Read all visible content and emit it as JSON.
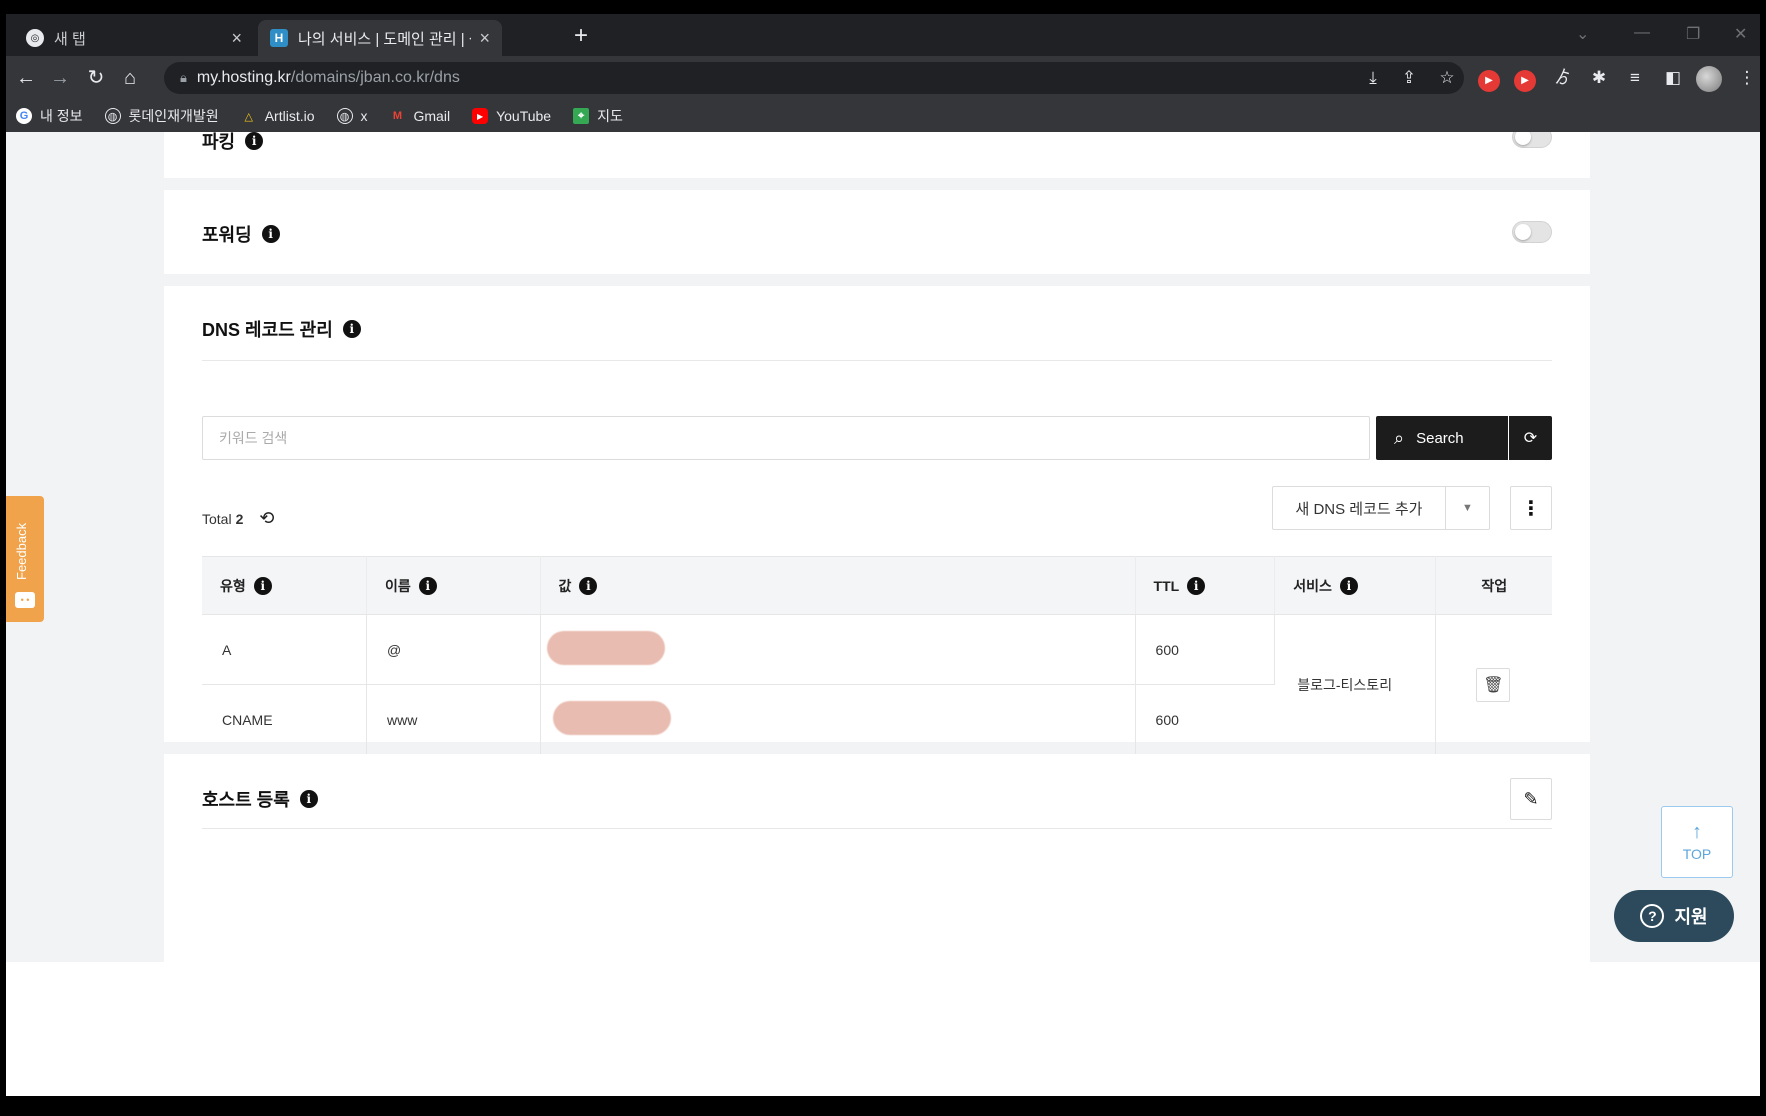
{
  "browser": {
    "tabs": [
      {
        "title": "새 탭",
        "favicon": "chrome-icon",
        "active": false
      },
      {
        "title": "나의 서비스 | 도메인 관리 | 상세",
        "favicon": "H",
        "active": true
      }
    ],
    "new_tab": "+",
    "address": {
      "host": "my.hosting.kr",
      "path": "/domains/jban.co.kr/dns"
    },
    "bookmarks": [
      {
        "label": "내 정보",
        "icon": "google-icon"
      },
      {
        "label": "롯데인재개발원",
        "icon": "globe-icon"
      },
      {
        "label": "Artlist.io",
        "icon": "artlist-icon"
      },
      {
        "label": "x",
        "icon": "globe-icon"
      },
      {
        "label": "Gmail",
        "icon": "gmail-icon"
      },
      {
        "label": "YouTube",
        "icon": "youtube-icon"
      },
      {
        "label": "지도",
        "icon": "maps-icon"
      }
    ]
  },
  "sections": {
    "parking": {
      "title": "파킹"
    },
    "forwarding": {
      "title": "포워딩"
    },
    "dns": {
      "title": "DNS 레코드 관리",
      "search_placeholder": "키워드 검색",
      "search_label": "Search",
      "total_label": "Total",
      "total_count": "2",
      "add_record_label": "새 DNS 레코드 추가",
      "columns": [
        "유형",
        "이름",
        "값",
        "TTL",
        "서비스",
        "작업"
      ],
      "rows": [
        {
          "type": "A",
          "name": "@",
          "ttl": "600"
        },
        {
          "type": "CNAME",
          "name": "www",
          "ttl": "600"
        }
      ],
      "service": "블로그-티스토리"
    },
    "host": {
      "title": "호스트 등록"
    }
  },
  "floating": {
    "feedback_label": "Feedback",
    "top_label": "TOP",
    "support_label": "지원"
  },
  "colors": {
    "accent_dark": "#1c1c1c",
    "feedback": "#f0a34a",
    "support": "#2c4a5c",
    "top_button": "#5ea6dc"
  }
}
